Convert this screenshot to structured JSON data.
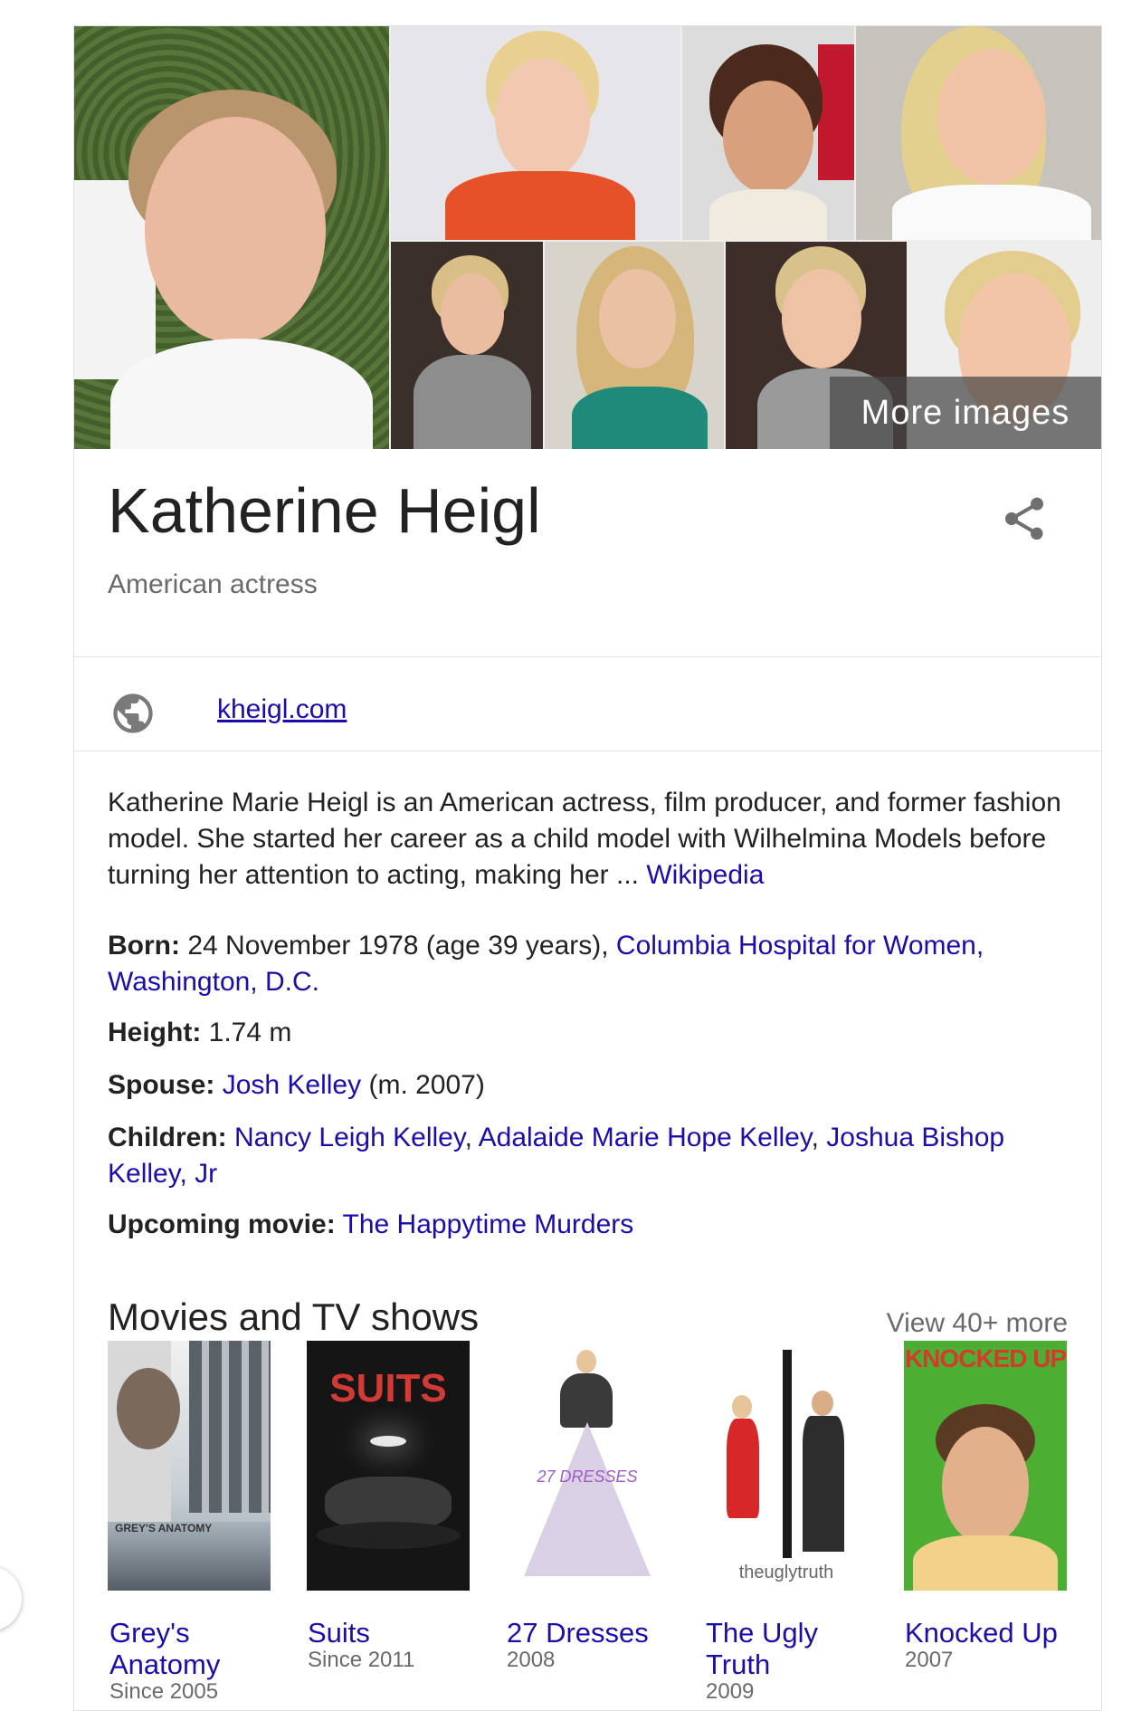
{
  "gallery": {
    "more_images_label": "More images"
  },
  "entity": {
    "name": "Katherine Heigl",
    "subtitle": "American actress"
  },
  "website": {
    "link_text": "kheigl.com"
  },
  "description": {
    "text": "Katherine Marie Heigl is an American actress, film producer, and former fashion model. She started her career as a child model with Wilhelmina Models before turning her attention to acting, making her ... ",
    "source_link": "Wikipedia"
  },
  "facts": {
    "born_label": "Born:",
    "born_text": " 24 November 1978 (age 39 years), ",
    "born_link": "Columbia Hospital for Women, Washington, D.C.",
    "height_label": "Height:",
    "height_value": " 1.74 m",
    "spouse_label": "Spouse:",
    "spouse_link": "Josh Kelley",
    "spouse_note": " (m. 2007)",
    "children_label": "Children:",
    "children_link_1": "Nancy Leigh Kelley",
    "children_link_2": "Adalaide Marie Hope Kelley",
    "children_link_3": "Joshua Bishop Kelley, Jr",
    "comma": ", ",
    "upcoming_label": "Upcoming movie:",
    "upcoming_link": "The Happytime Murders"
  },
  "movies": {
    "section_title": "Movies and TV shows",
    "view_more": "View 40+ more",
    "items": [
      {
        "title": "Grey's Anatomy",
        "subtitle": "Since 2005",
        "poster_text": "GREY'S ANATOMY"
      },
      {
        "title": "Suits",
        "subtitle": "Since 2011",
        "poster_text": "SUITS"
      },
      {
        "title": "27 Dresses",
        "subtitle": "2008",
        "poster_text": "27 DRESSES"
      },
      {
        "title": "The Ugly Truth",
        "subtitle": "2009",
        "poster_text": "theuglytruth"
      },
      {
        "title": "Knocked Up",
        "subtitle": "2007",
        "poster_text": "KNOCKED UP"
      }
    ]
  },
  "colors": {
    "link": "#1a0dab",
    "muted": "#6a6a6a",
    "text": "#222222"
  }
}
